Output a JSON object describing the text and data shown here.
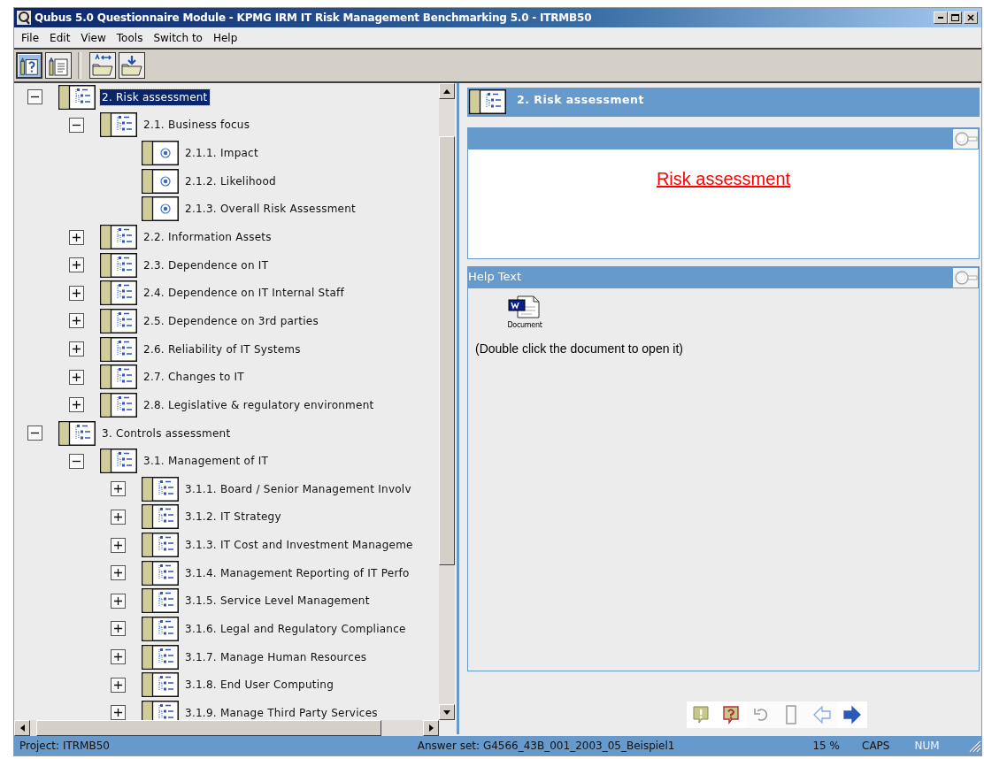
{
  "window": {
    "title": "Qubus 5.0 Questionnaire Module - KPMG IRM IT Risk Management Benchmarking 5.0 - ITRMB50"
  },
  "menu": [
    "File",
    "Edit",
    "View",
    "Tools",
    "Switch to",
    "Help"
  ],
  "toolbar": [
    {
      "kind": "question-book",
      "selected": true
    },
    {
      "kind": "text-book",
      "selected": false
    },
    {
      "kind": "folder-swap",
      "selected": false
    },
    {
      "kind": "folder-import",
      "selected": false
    }
  ],
  "tree": [
    {
      "label": "2. Risk assessment",
      "kind": "section",
      "expanded": true,
      "selected": true,
      "children": [
        {
          "label": "2.1. Business focus",
          "kind": "section",
          "expanded": true,
          "selected": false,
          "children": [
            {
              "label": "2.1.1. Impact",
              "kind": "question",
              "selected": false
            },
            {
              "label": "2.1.2. Likelihood",
              "kind": "question",
              "selected": false
            },
            {
              "label": "2.1.3. Overall Risk Assessment",
              "kind": "question",
              "selected": false
            }
          ]
        },
        {
          "label": "2.2. Information Assets",
          "kind": "section",
          "expanded": false,
          "selected": false
        },
        {
          "label": "2.3. Dependence on IT",
          "kind": "section",
          "expanded": false,
          "selected": false
        },
        {
          "label": "2.4. Dependence on IT Internal Staff",
          "kind": "section",
          "expanded": false,
          "selected": false
        },
        {
          "label": "2.5. Dependence on 3rd parties",
          "kind": "section",
          "expanded": false,
          "selected": false
        },
        {
          "label": "2.6. Reliability of IT Systems",
          "kind": "section",
          "expanded": false,
          "selected": false
        },
        {
          "label": "2.7. Changes to IT",
          "kind": "section",
          "expanded": false,
          "selected": false
        },
        {
          "label": "2.8. Legislative & regulatory environment",
          "kind": "section",
          "expanded": false,
          "selected": false
        }
      ]
    },
    {
      "label": "3. Controls assessment",
      "kind": "section",
      "expanded": true,
      "selected": false,
      "children": [
        {
          "label": "3.1. Management of IT",
          "kind": "section",
          "expanded": true,
          "selected": false,
          "children": [
            {
              "label": "3.1.1. Board / Senior Management Involv",
              "kind": "section",
              "expanded": false,
              "selected": false
            },
            {
              "label": "3.1.2. IT Strategy",
              "kind": "section",
              "expanded": false,
              "selected": false
            },
            {
              "label": "3.1.3. IT Cost and Investment Manageme",
              "kind": "section",
              "expanded": false,
              "selected": false
            },
            {
              "label": "3.1.4. Management Reporting of IT Perfo",
              "kind": "section",
              "expanded": false,
              "selected": false
            },
            {
              "label": "3.1.5. Service Level Management",
              "kind": "section",
              "expanded": false,
              "selected": false
            },
            {
              "label": "3.1.6. Legal and Regulatory Compliance",
              "kind": "section",
              "expanded": false,
              "selected": false
            },
            {
              "label": "3.1.7. Manage Human Resources",
              "kind": "section",
              "expanded": false,
              "selected": false
            },
            {
              "label": "3.1.8. End User Computing",
              "kind": "section",
              "expanded": false,
              "selected": false
            },
            {
              "label": "3.1.9. Manage Third Party Services",
              "kind": "section",
              "expanded": false,
              "selected": false
            }
          ]
        }
      ]
    }
  ],
  "detail": {
    "heading": "2. Risk assessment",
    "question_title": "Risk assessment",
    "help_title": "Help Text",
    "attachment_label": "Document",
    "help_note": "(Double click the document to open it)"
  },
  "navigation": [
    {
      "kind": "note",
      "disabled": false
    },
    {
      "kind": "query",
      "disabled": false
    },
    {
      "kind": "undo",
      "disabled": true
    },
    {
      "kind": "blank",
      "disabled": true
    },
    {
      "kind": "back",
      "disabled": true
    },
    {
      "kind": "forward",
      "disabled": false
    }
  ],
  "status_bar": {
    "project": "Project: ITRMB50",
    "answer_set": "Answer set: G4566_43B_001_2003_05_Beispiel1",
    "progress": "15 %",
    "indicators": [
      {
        "label": "CAPS",
        "on": true
      },
      {
        "label": "NUM",
        "on": false
      }
    ]
  }
}
